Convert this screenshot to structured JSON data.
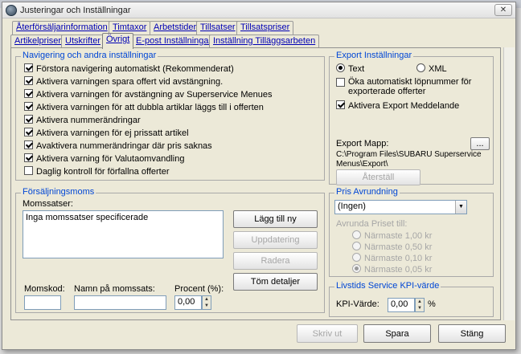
{
  "window": {
    "title": "Justeringar och Inställningar",
    "close_glyph": "✕"
  },
  "tabs_row1": [
    "Återförsäljarinformation",
    "Timtaxor",
    "Arbetstider",
    "Tillsatser",
    "Tillsatspriser"
  ],
  "tabs_row2": [
    "Artikelpriser",
    "Utskrifter",
    "Övrigt",
    "E-post Inställningar",
    "Inställning Tilläggsarbeten"
  ],
  "active_tab": "Övrigt",
  "nav": {
    "title": "Navigering och andra inställningar",
    "items": [
      {
        "label": "Förstora navigering automatiskt (Rekommenderat)",
        "checked": true
      },
      {
        "label": "Aktivera varningen spara offert vid avstängning.",
        "checked": true
      },
      {
        "label": "Aktivera varningen för avstängning av Superservice Menues",
        "checked": true
      },
      {
        "label": "Aktivera varningen för att dubbla artiklar läggs till i offerten",
        "checked": true
      },
      {
        "label": "Aktivera nummerändringar",
        "checked": true
      },
      {
        "label": "Aktivera varningen för ej prissatt artikel",
        "checked": true
      },
      {
        "label": "Avaktivera nummerändringar där pris saknas",
        "checked": true
      },
      {
        "label": "Aktivera varning för Valutaomvandling",
        "checked": true
      },
      {
        "label": "Daglig kontroll för förfallna offerter",
        "checked": false
      }
    ]
  },
  "export": {
    "title": "Export Inställningar",
    "radio_text": "Text",
    "radio_xml": "XML",
    "selected": "Text",
    "opt_auto_number": "Öka automatiskt löpnummer för exporterade offerter",
    "opt_auto_number_checked": false,
    "opt_message": "Aktivera Export Meddelande",
    "opt_message_checked": true,
    "folder_label": "Export Mapp:",
    "browse_label": "...",
    "folder_path": "C:\\Program Files\\SUBARU Superservice Menus\\Export\\",
    "reset_label": "Återställ"
  },
  "vat": {
    "title": "Försäljningsmoms",
    "list_label": "Momssatser:",
    "list_empty": "Inga momssatser specificerade",
    "add_label": "Lägg till ny",
    "update_label": "Uppdatering",
    "delete_label": "Radera",
    "clear_label": "Töm detaljer",
    "code_label": "Momskod:",
    "name_label": "Namn på momssats:",
    "percent_label": "Procent (%):",
    "code_value": "",
    "name_value": "",
    "percent_value": "0,00"
  },
  "rounding": {
    "title": "Pris Avrundning",
    "select_value": "(Ingen)",
    "sub_label": "Avrunda Priset till:",
    "options": [
      "Närmaste 1,00 kr",
      "Närmaste 0,50 kr",
      "Närmaste 0,10 kr",
      "Närmaste 0,05 kr"
    ],
    "selected_index": 3
  },
  "kpi": {
    "title": "Livstids Service KPI-värde",
    "label": "KPI-Värde:",
    "value": "0,00",
    "unit": "%"
  },
  "footer": {
    "print_label": "Skriv ut",
    "save_label": "Spara",
    "close_label": "Stäng"
  }
}
